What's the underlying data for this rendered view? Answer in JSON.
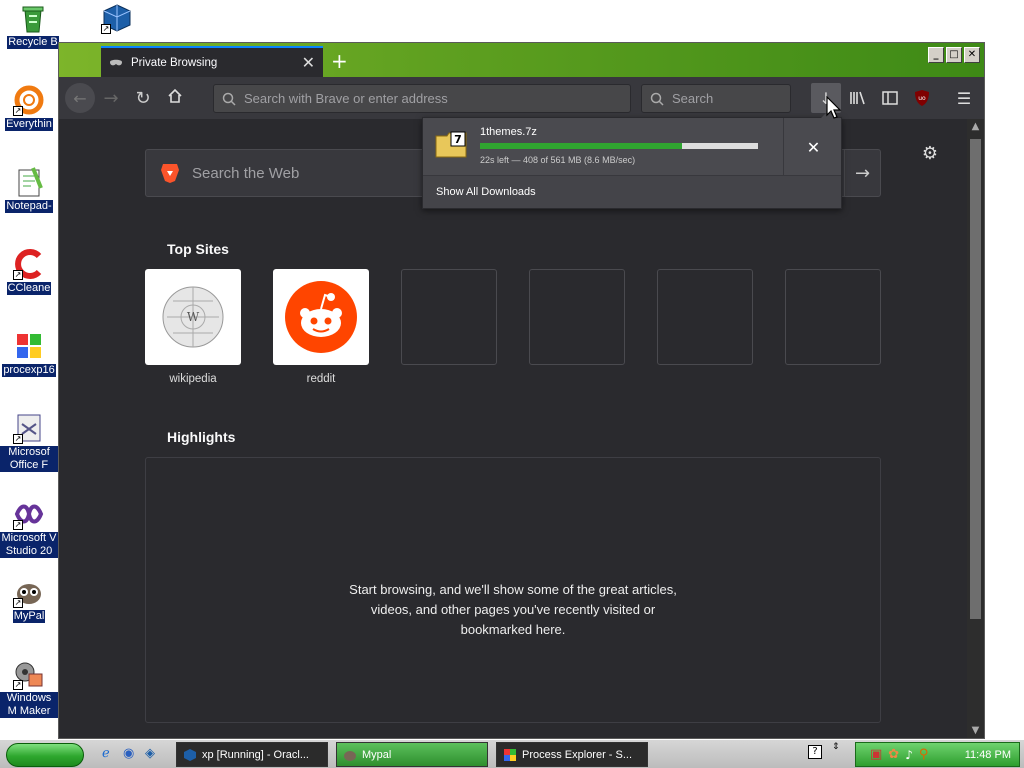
{
  "desktop": {
    "icons": [
      {
        "label": "Recycle B",
        "name": "recycle-bin-icon"
      },
      {
        "label": "",
        "name": "virtualbox-icon"
      },
      {
        "label": "Everythin",
        "name": "everything-icon"
      },
      {
        "label": "Notepad-",
        "name": "notepad-plus-icon"
      },
      {
        "label": "CCleane",
        "name": "ccleaner-icon"
      },
      {
        "label": "procexp16",
        "name": "process-explorer-icon"
      },
      {
        "label": "Microsof Office F",
        "name": "office-icon"
      },
      {
        "label": "Microsoft V Studio 20",
        "name": "visual-studio-icon"
      },
      {
        "label": "MyPal",
        "name": "mypal-icon"
      },
      {
        "label": "Windows M Maker",
        "name": "movie-maker-icon"
      }
    ]
  },
  "browser": {
    "tab": {
      "label": "Private Browsing"
    },
    "address_placeholder": "Search with Brave or enter address",
    "search_placeholder": "Search",
    "toolbar_badge": "uo"
  },
  "newtab": {
    "web_search_placeholder": "Search the Web",
    "top_sites_title": "Top Sites",
    "top_sites": [
      {
        "name": "wikipedia"
      },
      {
        "name": "reddit"
      }
    ],
    "highlights_title": "Highlights",
    "highlights_empty": "Start browsing, and we'll show some of the great articles, videos, and other pages you've recently visited or bookmarked here."
  },
  "downloads": {
    "filename": "1themes.7z",
    "status": "22s left — 408 of 561 MB (8.6 MB/sec)",
    "progress": 0.727,
    "show_all": "Show All Downloads",
    "file_icon_badge": "7"
  },
  "taskbar": {
    "tasks": [
      {
        "label": "xp [Running] - Oracl..."
      },
      {
        "label": "Mypal"
      },
      {
        "label": "Process Explorer - S..."
      }
    ],
    "clock": "11:48 PM"
  }
}
